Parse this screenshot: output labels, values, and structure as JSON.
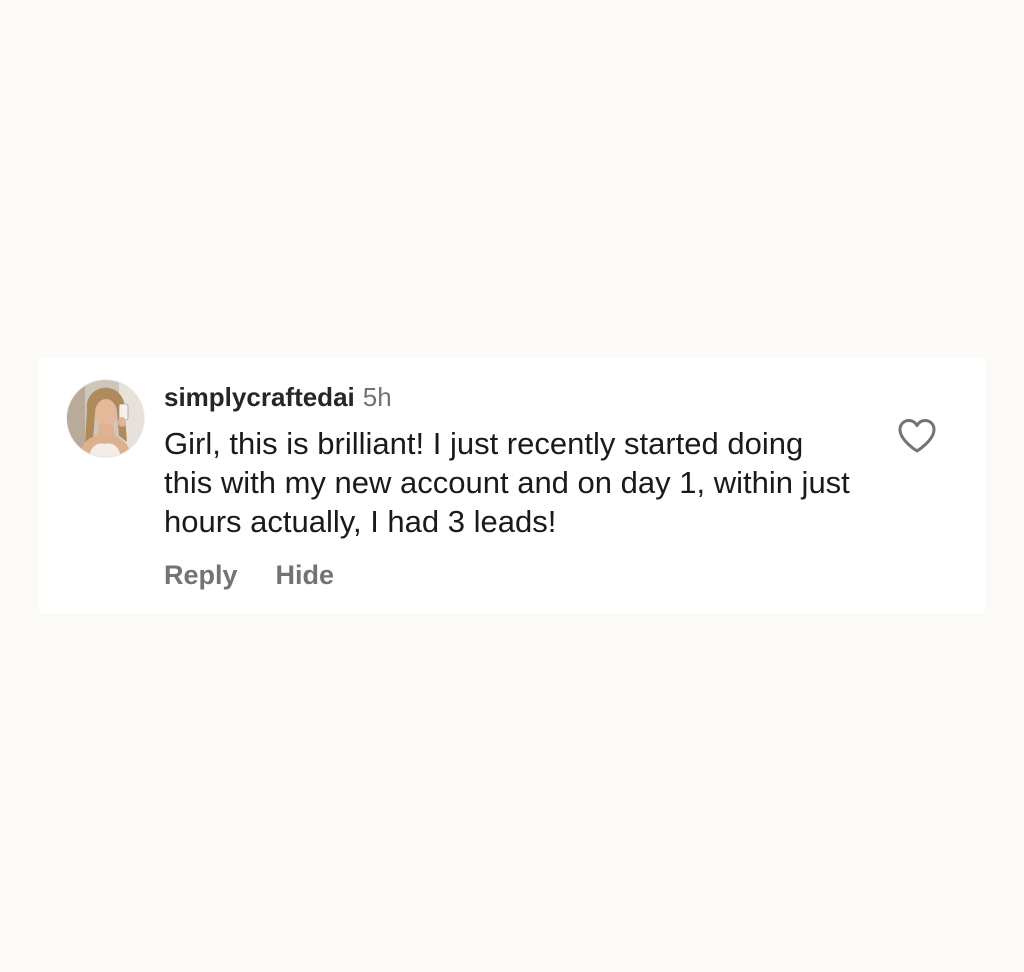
{
  "comment": {
    "username": "simplycraftedai",
    "timestamp": "5h",
    "text": "Girl, this is brilliant! I just recently started doing this with my new account and on day 1, within just hours actually, I had 3 leads!",
    "avatar_icon": "profile-photo-avatar",
    "like_icon": "heart-outline-icon"
  },
  "actions": {
    "reply_label": "Reply",
    "hide_label": "Hide"
  },
  "colors": {
    "page_background": "#fbfaf7",
    "card_background": "#ffffff",
    "username": "#262626",
    "secondary_text": "#737373",
    "body_text": "#1a1a1a"
  }
}
